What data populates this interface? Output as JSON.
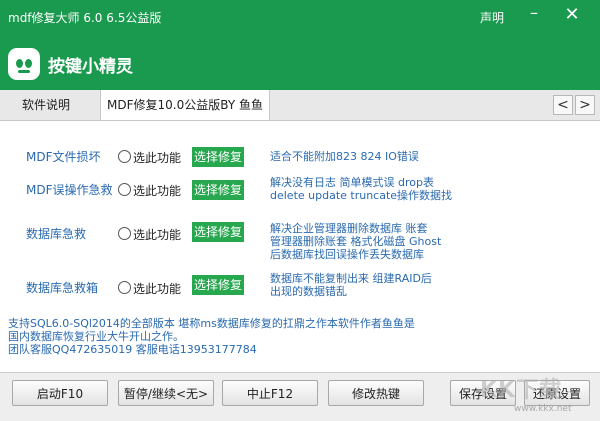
{
  "window": {
    "title": "mdf修复大师 6.0 6.5公益版",
    "menu_label": "声明",
    "minimize_icon": "minimize-icon",
    "close_icon": "close-icon"
  },
  "header": {
    "brand": "按键小精灵",
    "logo_icon": "robot-logo-icon",
    "accent_color": "#1a9a4f"
  },
  "tabs": [
    {
      "label": "软件说明",
      "active": false
    },
    {
      "label": "MDF修复10.0公益版BY 鱼鱼",
      "active": true
    }
  ],
  "tab_nav": {
    "prev": "<",
    "next": ">"
  },
  "functions": [
    {
      "label": "MDF文件损坏",
      "radio_label": "选此功能",
      "button": "选择修复",
      "desc": [
        "适合不能附加823 824 IO错误"
      ]
    },
    {
      "label": "MDF误操作急救",
      "radio_label": "选此功能",
      "button": "选择修复",
      "desc": [
        "解决没有日志 简单模式误 drop表",
        "delete update  truncate操作数据找"
      ]
    },
    {
      "label": "数据库急救",
      "radio_label": "选此功能",
      "button": "选择修复",
      "desc": [
        "解决企业管理器删除数据库 账套",
        "管理器删除账套 格式化磁盘 Ghost",
        "后数据库找回误操作丢失数据库"
      ]
    },
    {
      "label": "数据库急救箱",
      "radio_label": "选此功能",
      "button": "选择修复",
      "desc": [
        "数据库不能复制出来 组建RAID后",
        "出现的数据错乱"
      ]
    }
  ],
  "info_lines": [
    "支持SQL6.0-SQl2014的全部版本 堪称ms数据库修复的扛鼎之作本软件作者鱼鱼是",
    "国内数据库恢复行业大牛开山之作。",
    "团队客服QQ472635019 客服电话13953177784"
  ],
  "buttons": {
    "start": "启动F10",
    "pause": "暂停/继续<无>",
    "stop": "中止F12",
    "hotkey": "修改热键",
    "save": "保存设置",
    "restore": "还原设置"
  },
  "watermark": {
    "text": "KK下载",
    "url": "www.kkx.net"
  }
}
